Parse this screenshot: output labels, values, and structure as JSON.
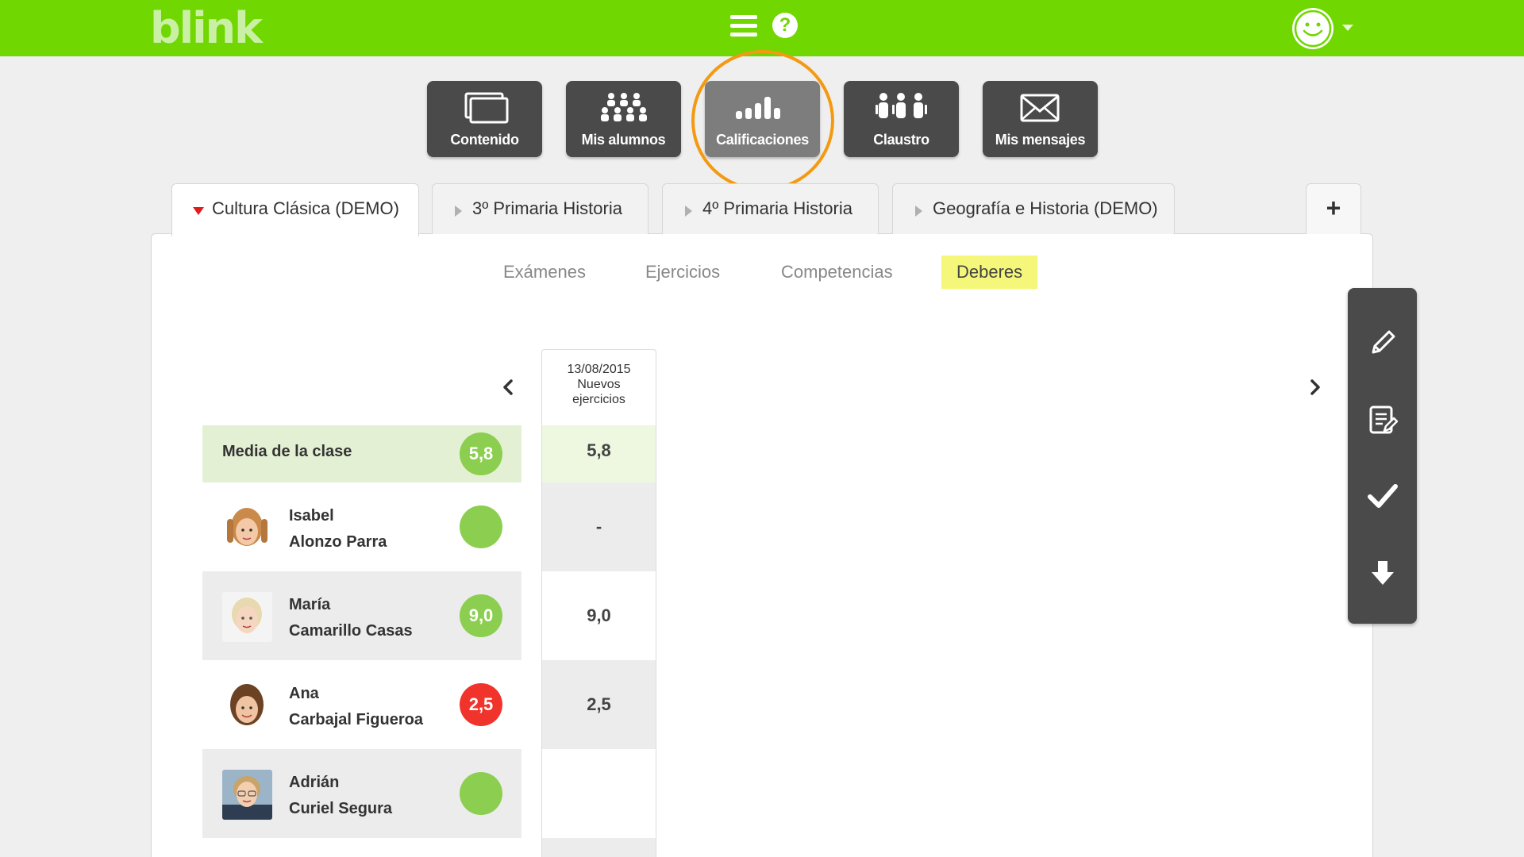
{
  "header": {
    "logo": "blink",
    "help_symbol": "?",
    "icons": [
      "hamburger-menu-icon",
      "help-icon",
      "smiley-avatar-icon",
      "caret-down-icon"
    ]
  },
  "nav": {
    "buttons": [
      {
        "label": "Contenido",
        "icon": "screens-icon",
        "active": false
      },
      {
        "label": "Mis alumnos",
        "icon": "students-icon",
        "active": false
      },
      {
        "label": "Calificaciones",
        "icon": "bar-chart-icon",
        "active": true
      },
      {
        "label": "Claustro",
        "icon": "teachers-icon",
        "active": false
      },
      {
        "label": "Mis mensajes",
        "icon": "envelope-icon",
        "active": false
      }
    ],
    "highlight_color": "#f39a12"
  },
  "tabs": {
    "items": [
      {
        "label": "Cultura Clásica (DEMO)",
        "active": true
      },
      {
        "label": "3º Primaria Historia",
        "active": false
      },
      {
        "label": "4º Primaria Historia",
        "active": false
      },
      {
        "label": "Geografía e Historia (DEMO)",
        "active": false
      }
    ],
    "add_label": "+"
  },
  "subtabs": {
    "items": [
      {
        "label": "Exámenes",
        "active": false
      },
      {
        "label": "Ejercicios",
        "active": false
      },
      {
        "label": "Competencias",
        "active": false
      },
      {
        "label": "Deberes",
        "active": true
      }
    ]
  },
  "grades": {
    "column": {
      "date": "13/08/2015",
      "title_line1": "Nuevos",
      "title_line2": "ejercicios"
    },
    "average": {
      "label": "Media de la clase",
      "badge": "5,8",
      "value": "5,8"
    },
    "students": [
      {
        "first": "Isabel",
        "last": "Alonzo Parra",
        "badge": "",
        "badge_color": "green",
        "value": "-"
      },
      {
        "first": "María",
        "last": "Camarillo Casas",
        "badge": "9,0",
        "badge_color": "green",
        "value": "9,0"
      },
      {
        "first": "Ana",
        "last": "Carbajal Figueroa",
        "badge": "2,5",
        "badge_color": "red",
        "value": "2,5"
      },
      {
        "first": "Adrián",
        "last": "Curiel Segura",
        "badge": "",
        "badge_color": "green",
        "value": ""
      }
    ]
  },
  "toolbar": {
    "tools": [
      "pencil-icon",
      "edit-notes-icon",
      "checkmark-icon",
      "download-arrow-icon"
    ]
  },
  "colors": {
    "brand_green": "#70d700",
    "badge_green": "#8ccf50",
    "badge_red": "#f0332b",
    "active_subtab": "#f4f77a",
    "dark_button": "#4a4a4a"
  }
}
